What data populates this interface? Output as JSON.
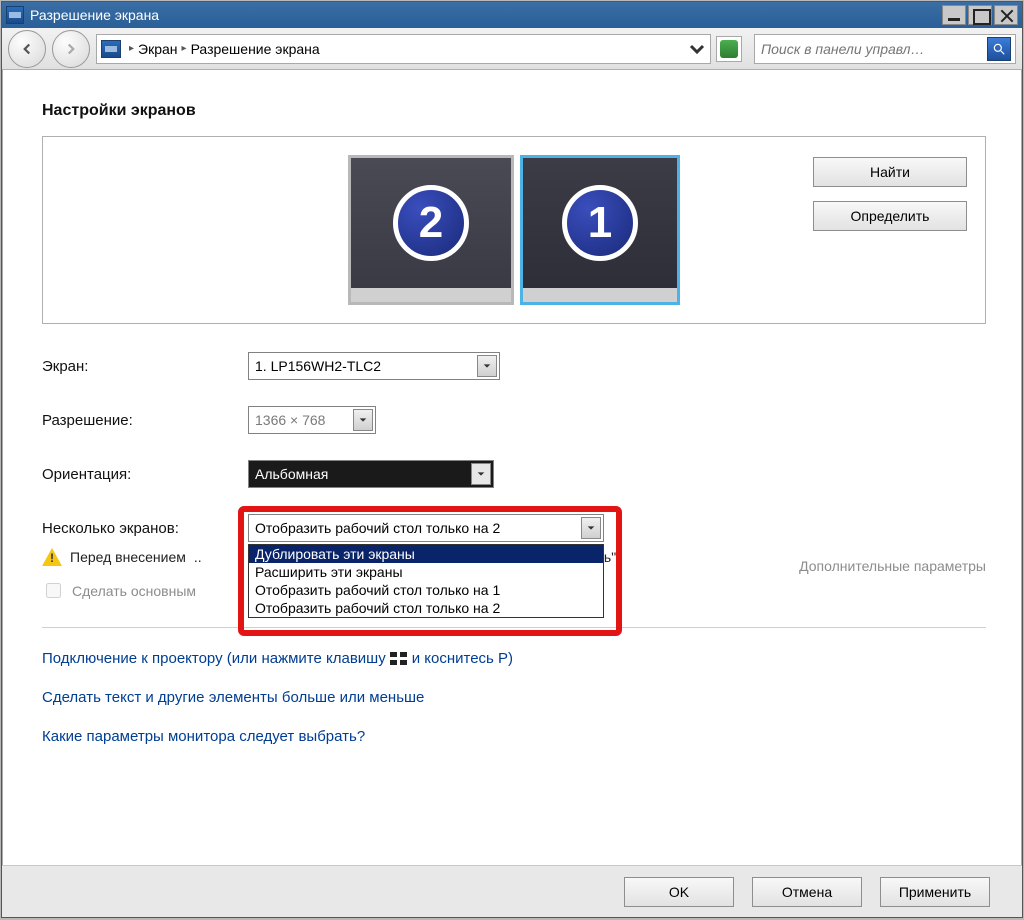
{
  "title": "Разрешение экрана",
  "breadcrumb": {
    "seg1": "Экран",
    "seg2": "Разрешение экрана"
  },
  "search_placeholder": "Поиск в панели управл…",
  "page_heading": "Настройки экранов",
  "monitors": {
    "secondary": "2",
    "primary": "1"
  },
  "side_buttons": {
    "find": "Найти",
    "identify": "Определить"
  },
  "labels": {
    "display": "Экран:",
    "resolution": "Разрешение:",
    "orientation": "Ориентация:",
    "multiple": "Несколько экранов:"
  },
  "values": {
    "display": "1. LP156WH2-TLC2",
    "resolution": "1366 × 768",
    "orientation": "Альбомная",
    "multiple": "Отобразить рабочий стол только на 2"
  },
  "multi_options": [
    "Дублировать эти экраны",
    "Расширить эти экраны",
    "Отобразить рабочий стол только на 1",
    "Отобразить рабочий стол только на 2"
  ],
  "warn_prefix": "Перед внесением",
  "warn_suffix": "ить\".",
  "make_primary": "Сделать основным",
  "advanced": "Дополнительные параметры",
  "link_projector_pre": "Подключение к проектору (или нажмите клавишу",
  "link_projector_post": "и коснитесь P)",
  "link_textsize": "Сделать текст и другие элементы больше или меньше",
  "link_which": "Какие параметры монитора следует выбрать?",
  "footer": {
    "ok": "OK",
    "cancel": "Отмена",
    "apply": "Применить"
  }
}
